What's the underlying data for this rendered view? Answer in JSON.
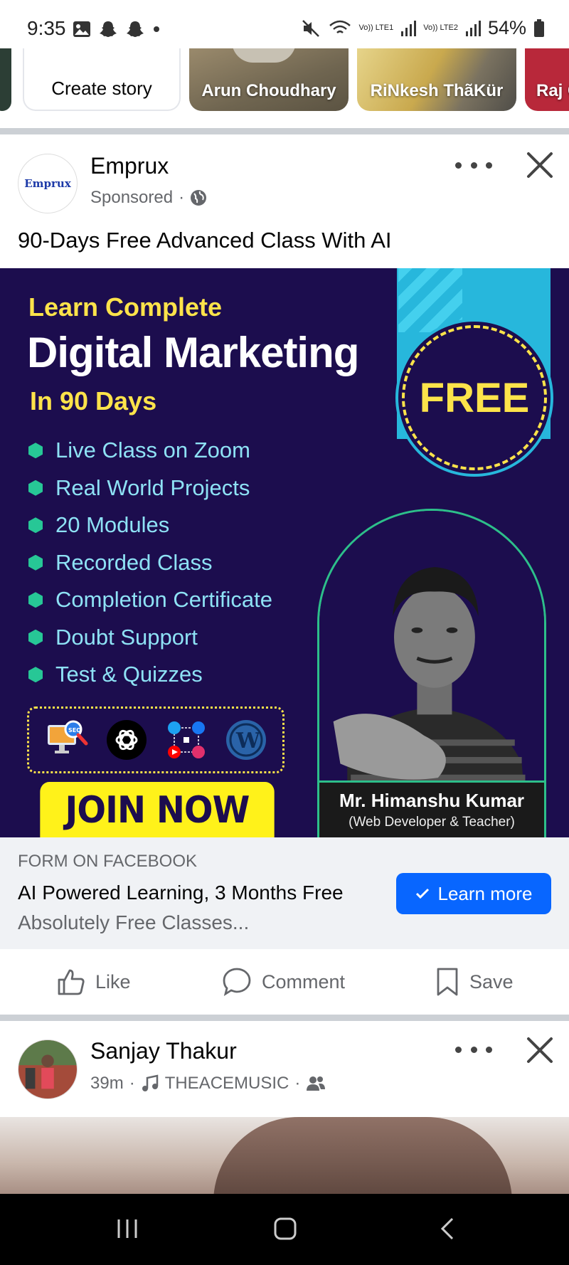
{
  "status_bar": {
    "time": "9:35",
    "network1": "Vo)) LTE1",
    "network2": "Vo)) LTE2",
    "battery": "54%"
  },
  "stories": {
    "create_label": "Create story",
    "items": [
      {
        "name": "Arun Choudhary"
      },
      {
        "name": "RiNkesh ThãKür"
      },
      {
        "name": "Raj C"
      }
    ]
  },
  "post1": {
    "author": "Emprux",
    "avatar_text": "Emprux",
    "meta": "Sponsored",
    "caption": "90-Days Free Advanced Class With AI",
    "ad": {
      "line1": "Learn Complete",
      "line2": "Digital Marketing",
      "line3": "In 90 Days",
      "badge": "FREE",
      "features": [
        "Live Class on Zoom",
        "Real World Projects",
        "20 Modules",
        "Recorded Class",
        "Completion Certificate",
        "Doubt Support",
        "Test & Quizzes"
      ],
      "icons": [
        "seo-monitor-icon",
        "chatgpt-icon",
        "social-media-icon",
        "wordpress-icon"
      ],
      "cta": "JOIN NOW",
      "presenter_name": "Mr. Himanshu Kumar",
      "presenter_role": "(Web Developer & Teacher)"
    },
    "form": {
      "label": "FORM ON FACEBOOK",
      "title": "AI Powered Learning, 3 Months Free",
      "subtitle": "Absolutely Free Classes...",
      "button": "Learn more"
    },
    "actions": {
      "like": "Like",
      "comment": "Comment",
      "save": "Save"
    }
  },
  "post2": {
    "author": "Sanjay Thakur",
    "time": "39m",
    "music": "THEACEMUSIC"
  },
  "colors": {
    "fb_blue": "#0866ff",
    "ad_purple": "#1c0d4e",
    "ad_yellow": "#fde34a",
    "ad_cyan": "#27b7dc"
  }
}
